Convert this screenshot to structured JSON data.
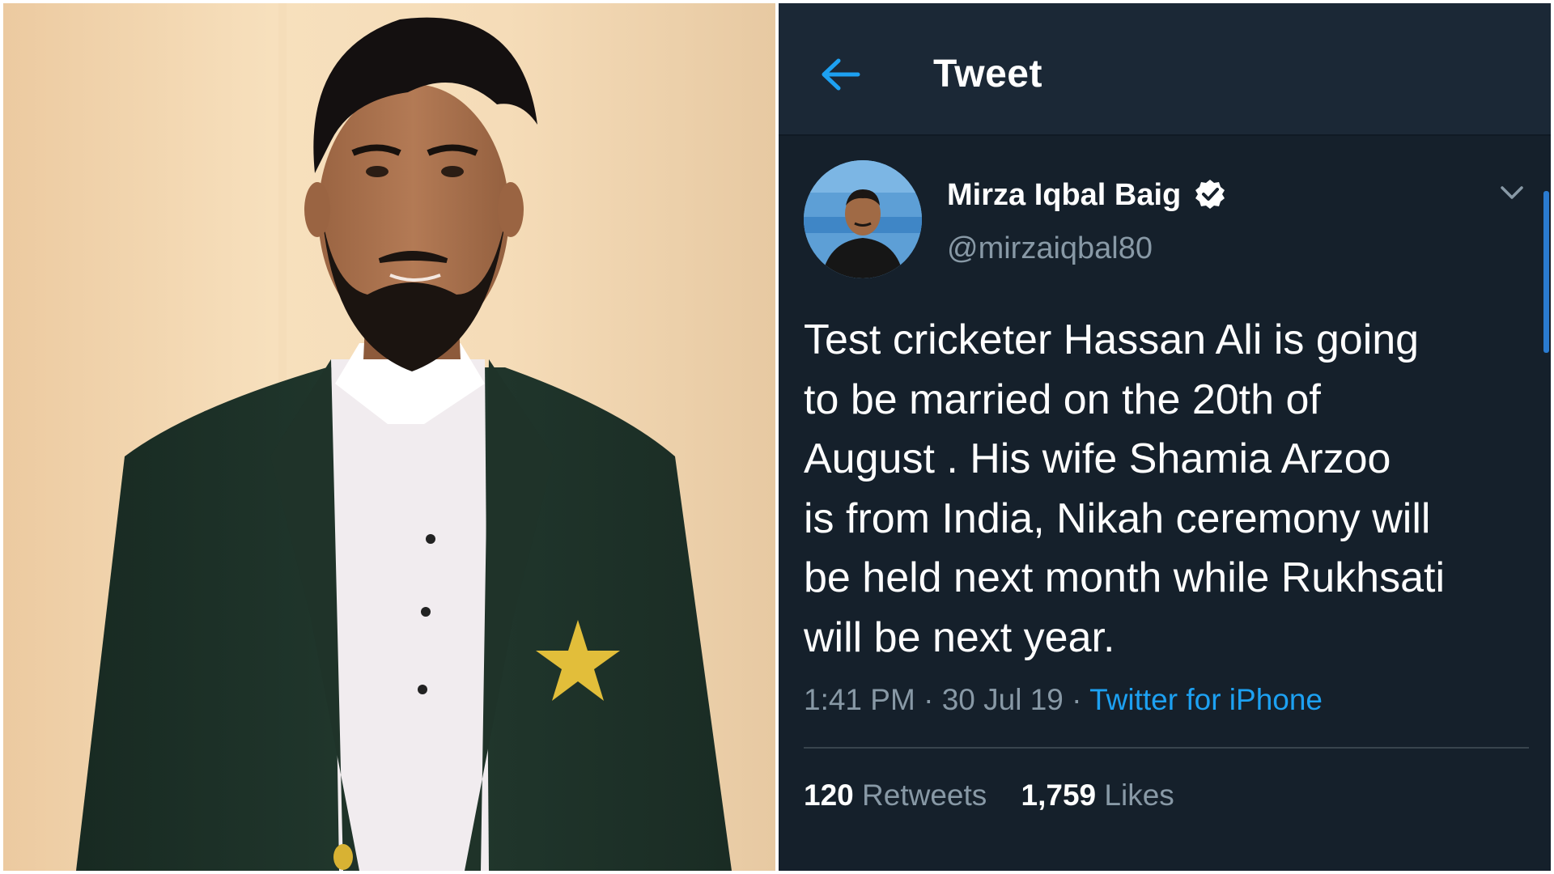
{
  "header": {
    "title": "Tweet",
    "back_icon": "arrow-left-icon"
  },
  "tweet": {
    "author_name": "Mirza Iqbal Baig",
    "author_handle": "@mirzaiqbal80",
    "verified_icon": "verified-badge-icon",
    "menu_icon": "chevron-down-icon",
    "text_lines": [
      "Test cricketer Hassan Ali is going",
      "to be married on the 20th of",
      "August . His wife Shamia Arzoo",
      "is from India, Nikah ceremony will",
      "be held next month while Rukhsati",
      "will be next year."
    ],
    "time": "1:41 PM",
    "date": "30 Jul 19",
    "separator": "·",
    "source": "Twitter for iPhone",
    "retweets_count": "120",
    "retweets_label": "Retweets",
    "likes_count": "1,759",
    "likes_label": "Likes"
  },
  "colors": {
    "background": "#15202b",
    "header_background": "#1b2836",
    "accent": "#1da1f2",
    "secondary_text": "#8899a6"
  }
}
